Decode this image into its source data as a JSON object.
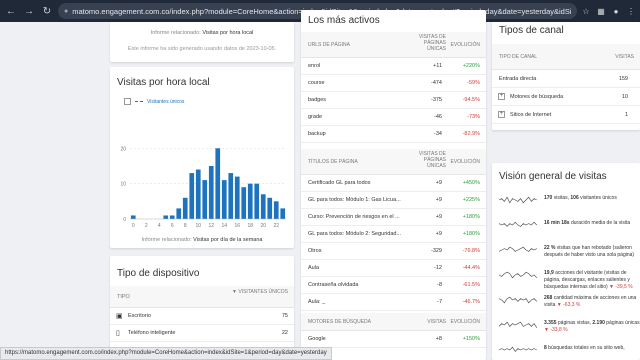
{
  "browser": {
    "url": "matomo.engagement.com.co/index.php?module=CoreHome&action=index&idSite=1&period=day&date=yesterday#?period=day&date=yesterday&idSite=1&category=Dashboa..."
  },
  "status_bar": "https://matomo.engagement.com.co/index.php?module=CoreHome&action=index&idSite=1&period=day&date=yesterday",
  "left_top": {
    "related_prefix": "Informe relacionado:",
    "related_link": "Visitas por hora local",
    "generated_note": "Este informe ha sido generado usando datos de 2023-10-05."
  },
  "visits_widget": {
    "title": "Visitas por hora local",
    "legend": "Visitantes únicos",
    "footer_prefix": "Informe relacionado:",
    "footer_link": "Visitas por día de la semana"
  },
  "chart_data": {
    "type": "bar",
    "x": [
      0,
      1,
      2,
      3,
      4,
      5,
      6,
      7,
      8,
      9,
      10,
      11,
      12,
      13,
      14,
      15,
      16,
      17,
      18,
      19,
      20,
      21,
      22,
      23
    ],
    "tick_labels": [
      "0",
      "2",
      "4",
      "6",
      "8",
      "10",
      "12",
      "14",
      "16",
      "18",
      "20",
      "22"
    ],
    "y_tick_labels": [
      "0",
      "10",
      "20"
    ],
    "ylim": [
      0,
      30
    ],
    "series": [
      {
        "name": "Visitantes únicos",
        "color": "#1e73be",
        "values": [
          1,
          0,
          0,
          0,
          0,
          1,
          1,
          3,
          6,
          13,
          14,
          11,
          15,
          20,
          11,
          13,
          12,
          9,
          10,
          10,
          7,
          6,
          5,
          3
        ]
      }
    ]
  },
  "device_widget": {
    "title": "Tipo de dispositivo",
    "col_type": "TIPO",
    "col_visitors": "VISITANTES ÚNICOS",
    "rows": [
      {
        "icon": "desktop-icon",
        "label": "Escritorio",
        "value": "75"
      },
      {
        "icon": "smartphone-icon",
        "label": "Teléfono inteligente",
        "value": "22"
      }
    ]
  },
  "middle": {
    "title": "Los más activos",
    "urls_header": {
      "c1": "URLS DE PÁGINA",
      "c2": "VISITAS DE PÁGINAS ÚNICAS",
      "c3": "EVOLUCIÓN"
    },
    "urls": [
      {
        "label": "enrol",
        "visits": "+11",
        "evo": "+220%",
        "dir": "pos"
      },
      {
        "label": "course",
        "visits": "-474",
        "evo": "-59%",
        "dir": "neg"
      },
      {
        "label": "badges",
        "visits": "-375",
        "evo": "-94.5%",
        "dir": "neg"
      },
      {
        "label": "grade",
        "visits": "-46",
        "evo": "-73%",
        "dir": "neg"
      },
      {
        "label": "backup",
        "visits": "-34",
        "evo": "-82.9%",
        "dir": "neg"
      }
    ],
    "titles_header": {
      "c1": "TÍTULOS DE PÁGINA",
      "c2": "VISITAS DE PÁGINAS ÚNICAS",
      "c3": "EVOLUCIÓN"
    },
    "titles": [
      {
        "label": "Certificado GL para todos",
        "visits": "+9",
        "evo": "+450%",
        "dir": "pos"
      },
      {
        "label": "GL para todos: Módulo 1: Gas Licua...",
        "visits": "+9",
        "evo": "+225%",
        "dir": "pos"
      },
      {
        "label": "Curso: Prevención de riesgos en el ...",
        "visits": "+9",
        "evo": "+180%",
        "dir": "pos"
      },
      {
        "label": "GL para todos: Módulo 2: Seguridad...",
        "visits": "+9",
        "evo": "+180%",
        "dir": "pos"
      },
      {
        "label": "Otros",
        "visits": "-329",
        "evo": "-76.8%",
        "dir": "neg"
      },
      {
        "label": "Aula",
        "visits": "-12",
        "evo": "-44.4%",
        "dir": "neg"
      },
      {
        "label": "Contraseña olvidada",
        "visits": "-8",
        "evo": "-61.5%",
        "dir": "neg"
      },
      {
        "label": "Aula: _",
        "visits": "-7",
        "evo": "-46.7%",
        "dir": "neg"
      }
    ],
    "search_header": {
      "c1": "MOTORES DE BÚSQUEDA",
      "c2": "VISITAS",
      "c3": "EVOLUCIÓN"
    },
    "search": [
      {
        "label": "Google",
        "visits": "+8",
        "evo": "+150%",
        "dir": "pos"
      }
    ]
  },
  "channel_widget": {
    "title": "Tipos de canal",
    "col_type": "TIPO DE CANAL",
    "col_visits": "VISITAS",
    "rows": [
      {
        "label": "Entrada directa",
        "value": "159",
        "expand": false
      },
      {
        "label": "Motores de búsqueda",
        "value": "10",
        "expand": true
      },
      {
        "label": "Sitios de Internet",
        "value": "1",
        "expand": true
      }
    ]
  },
  "overview_widget": {
    "title": "Visión general de visitas",
    "rows": [
      {
        "strong": "170",
        "text": " visitas, ",
        "strong2": "106",
        "text2": " visitantes únicos",
        "trend": "",
        "dir": ""
      },
      {
        "strong": "16 min 18s",
        "text": " duración media de la visita",
        "strong2": "",
        "text2": "",
        "trend": "",
        "dir": ""
      },
      {
        "strong": "22 %",
        "text": " visitas que han rebotado (salieron después de haber visto una sola página)",
        "strong2": "",
        "text2": "",
        "trend": "",
        "dir": ""
      },
      {
        "strong": "19,9",
        "text": " acciones del visitante (visitas de página, descargas, enlaces salientes y búsquedas internas del sitio)",
        "strong2": "",
        "text2": "",
        "trend": "-39,5 %",
        "dir": "neg"
      },
      {
        "strong": "268",
        "text": " cantidad máxima de acciones en una visita",
        "strong2": "",
        "text2": "",
        "trend": "-63,3 %",
        "dir": "neg"
      },
      {
        "strong": "3.355",
        "text": " páginas vistas, ",
        "strong2": "2.190",
        "text2": " páginas únicas",
        "trend": "-33,8 %",
        "dir": "neg"
      },
      {
        "strong": "8",
        "text": " búsquedas totales en su sitio web, ",
        "strong2": "",
        "text2": "",
        "trend": "",
        "dir": ""
      }
    ]
  }
}
